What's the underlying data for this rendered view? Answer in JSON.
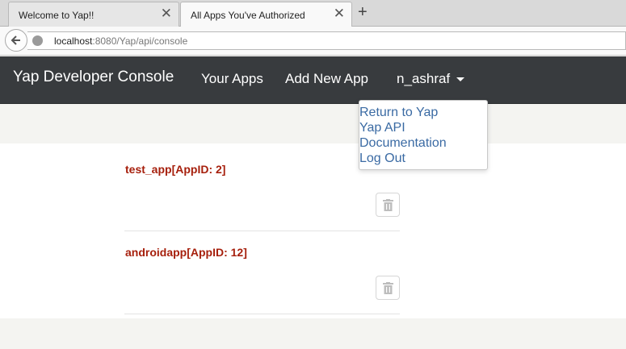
{
  "browser": {
    "tabs": [
      {
        "label": "Welcome to Yap!!",
        "active": false
      },
      {
        "label": "All Apps You've Authorized",
        "active": true
      }
    ],
    "new_tab": "+",
    "close_glyph": "✕",
    "url_host": "localhost",
    "url_rest": ":8080/Yap/api/console"
  },
  "nav": {
    "brand": "Yap Developer Console",
    "your_apps": "Your Apps",
    "add_new_app": "Add New App",
    "user": "n_ashraf"
  },
  "dropdown": {
    "items": [
      "Return to Yap",
      "Yap API",
      "Documentation",
      "Log Out"
    ]
  },
  "apps": [
    {
      "title": "test_app[AppID: 2]"
    },
    {
      "title": "androidapp[AppID: 12]"
    }
  ],
  "colors": {
    "navbar": "#383b3e",
    "app_title": "#a61f0c",
    "link": "#3a6aa3"
  },
  "icons": {
    "back": "back-arrow-icon",
    "globe": "globe-icon",
    "trash": "trash-icon",
    "caret": "caret-down-icon"
  }
}
